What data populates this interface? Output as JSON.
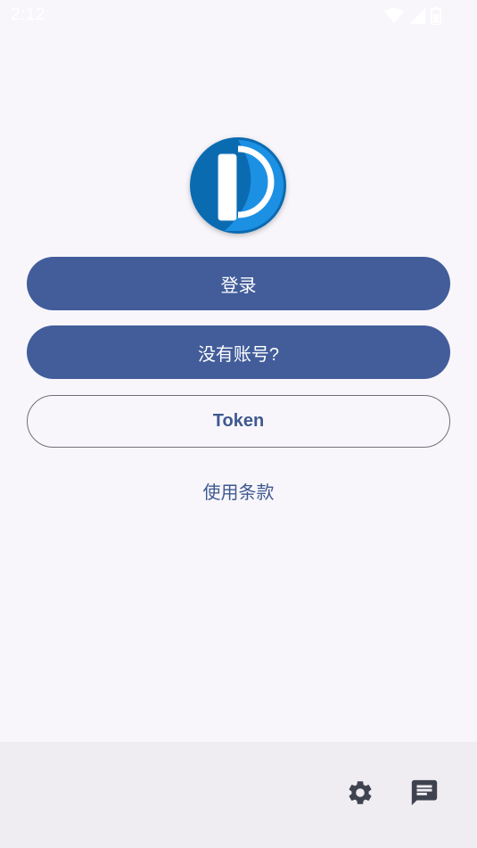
{
  "status_bar": {
    "time": "2:12",
    "icons": [
      "wifi-icon",
      "cellular-signal-icon",
      "battery-icon"
    ]
  },
  "logo": {
    "icon": "pixiv-logo-icon"
  },
  "actions": {
    "login_label": "登录",
    "register_label": "没有账号?",
    "token_label": "Token",
    "terms_label": "使用条款"
  },
  "bottom_bar": {
    "icons": [
      "gear-icon",
      "feedback-message-icon"
    ]
  },
  "colors": {
    "primary": "#425d9a",
    "link": "#3f5990",
    "background": "#f8f6fb",
    "bottom_bar": "#efedf1",
    "icon": "#3f4350"
  }
}
